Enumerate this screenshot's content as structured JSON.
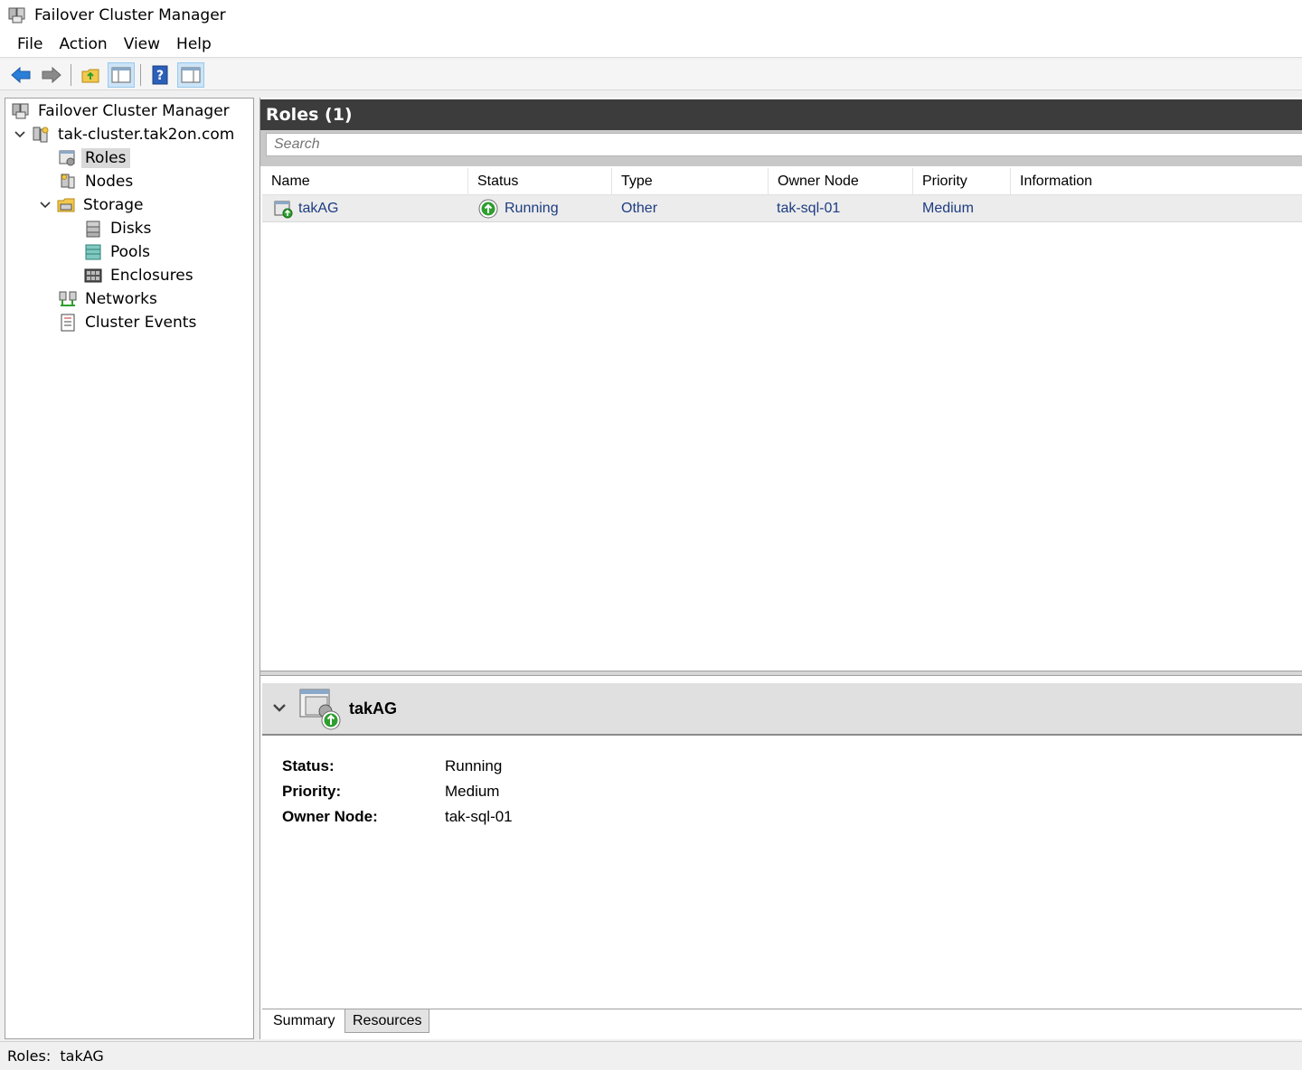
{
  "window": {
    "title": "Failover Cluster Manager"
  },
  "menu": [
    "File",
    "Action",
    "View",
    "Help"
  ],
  "toolbar": {
    "buttons": [
      "back-arrow-icon",
      "forward-arrow-icon",
      "up-folder-icon",
      "show-hide-console-tree-icon",
      "help-icon",
      "show-hide-action-pane-icon"
    ]
  },
  "tree": {
    "root": "Failover Cluster Manager",
    "cluster": "tak-cluster.tak2on.com",
    "roles": "Roles",
    "nodes": "Nodes",
    "storage": "Storage",
    "disks": "Disks",
    "pools": "Pools",
    "enclosures": "Enclosures",
    "networks": "Networks",
    "cluster_events": "Cluster Events"
  },
  "roles_panel": {
    "title": "Roles (1)",
    "search_placeholder": "Search",
    "columns": [
      "Name",
      "Status",
      "Type",
      "Owner Node",
      "Priority",
      "Information"
    ],
    "rows": [
      {
        "name": "takAG",
        "status": "Running",
        "type": "Other",
        "owner_node": "tak-sql-01",
        "priority": "Medium",
        "information": ""
      }
    ]
  },
  "detail": {
    "title": "takAG",
    "fields": [
      {
        "key": "Status:",
        "value": "Running"
      },
      {
        "key": "Priority:",
        "value": "Medium"
      },
      {
        "key": "Owner Node:",
        "value": "tak-sql-01"
      }
    ],
    "tabs": [
      "Summary",
      "Resources"
    ]
  },
  "statusbar": {
    "text": "Roles:  takAG"
  },
  "colors": {
    "header_dark": "#3c3c3c",
    "link_blue": "#1d3c80",
    "status_green": "#2e9e2e"
  }
}
